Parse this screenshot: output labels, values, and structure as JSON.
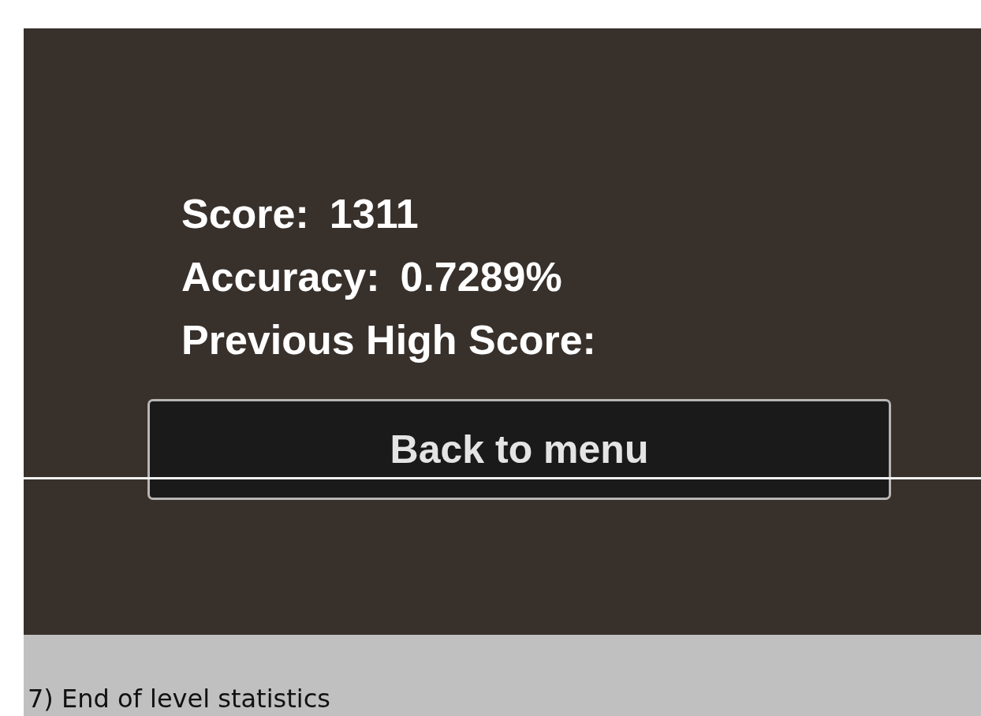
{
  "stats": [
    {
      "label": "Score:",
      "value": "1311"
    },
    {
      "label": "Accuracy:",
      "value": "0.7289%"
    },
    {
      "label": "Previous High Score:"
    }
  ],
  "button": {
    "label": "Back to menu"
  },
  "caption": "7) End of level statistics"
}
